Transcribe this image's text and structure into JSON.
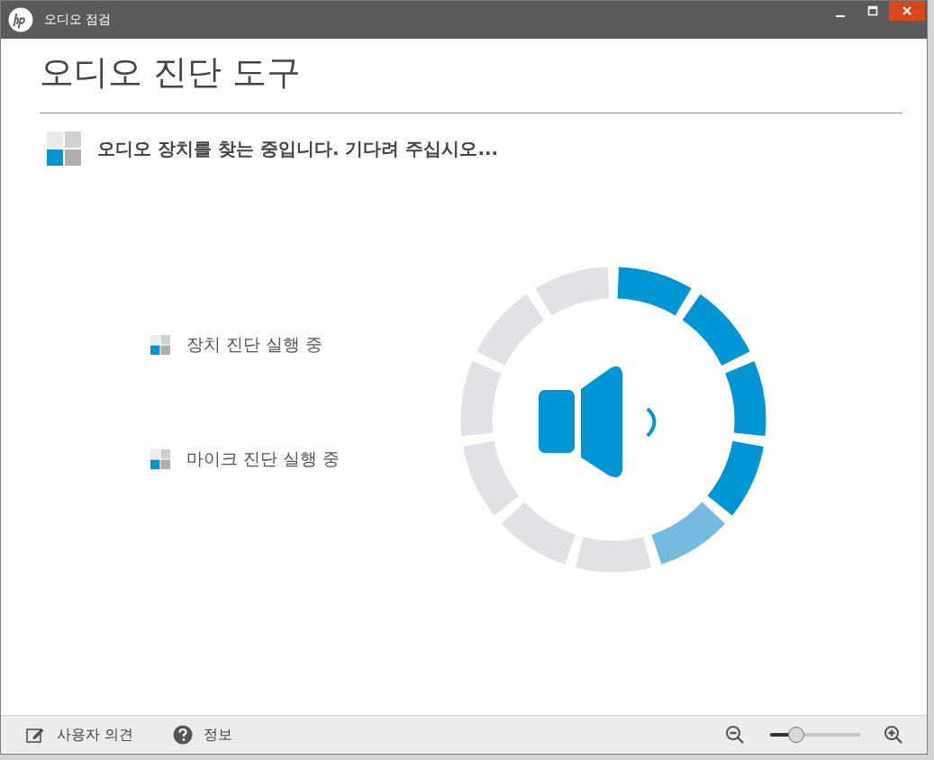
{
  "window": {
    "title": "오디오 점검"
  },
  "heading": "오디오 진단 도구",
  "status": "오디오 장치를 찾는 중입니다. 기다려 주십시오...",
  "tasks": [
    {
      "label": "장치 진단 실행 중"
    },
    {
      "label": "마이크 진단 실행 중"
    }
  ],
  "ring": {
    "segments": [
      {
        "done": true,
        "current": false
      },
      {
        "done": true,
        "current": false
      },
      {
        "done": true,
        "current": false
      },
      {
        "done": true,
        "current": false
      },
      {
        "done": false,
        "current": true
      },
      {
        "done": false,
        "current": false
      },
      {
        "done": false,
        "current": false
      },
      {
        "done": false,
        "current": false
      },
      {
        "done": false,
        "current": false
      },
      {
        "done": false,
        "current": false
      },
      {
        "done": false,
        "current": false
      }
    ]
  },
  "footer": {
    "feedback": "사용자 의견",
    "info": "정보",
    "zoom": {
      "level": 0.29
    }
  }
}
